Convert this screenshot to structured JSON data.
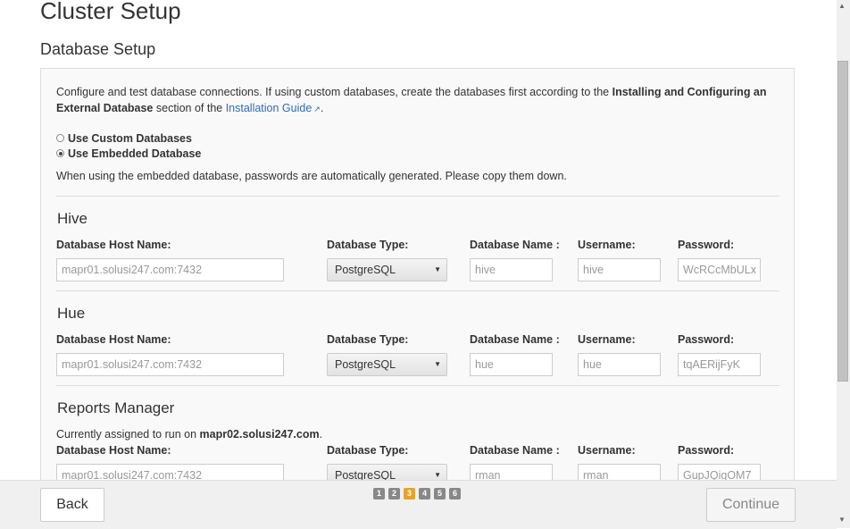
{
  "page_title": "Cluster Setup",
  "section_title": "Database Setup",
  "intro": {
    "text1": "Configure and test database connections. If using custom databases, create the databases first according to the ",
    "bold1": "Installing and Configuring an External Database",
    "text2": " section of the ",
    "link": "Installation Guide",
    "text3": "."
  },
  "radios": [
    {
      "label": "Use Custom Databases",
      "checked": false
    },
    {
      "label": "Use Embedded Database",
      "checked": true
    }
  ],
  "note": "When using the embedded database, passwords are automatically generated. Please copy them down.",
  "column_labels": {
    "host": "Database Host Name:",
    "type": "Database Type:",
    "name": "Database Name :",
    "user": "Username:",
    "pass": "Password:"
  },
  "services": [
    {
      "title": "Hive",
      "host": "mapr01.solusi247.com:7432",
      "type": "PostgreSQL",
      "db_name": "hive",
      "username": "hive",
      "password": "WcRCcMbULx"
    },
    {
      "title": "Hue",
      "host": "mapr01.solusi247.com:7432",
      "type": "PostgreSQL",
      "db_name": "hue",
      "username": "hue",
      "password": "tqAERijFyK"
    },
    {
      "title": "Reports Manager",
      "assigned_text": "Currently assigned to run on ",
      "assigned_host": "mapr02.solusi247.com",
      "assigned_end": ".",
      "host": "mapr01.solusi247.com:7432",
      "type": "PostgreSQL",
      "db_name": "rman",
      "username": "rman",
      "password": "GupJQigOM7"
    }
  ],
  "footer": {
    "back_label": "Back",
    "continue_label": "Continue",
    "steps": [
      "1",
      "2",
      "3",
      "4",
      "5",
      "6"
    ],
    "current_step": "3"
  },
  "colors": {
    "accent_step": "#e5a328",
    "link": "#2a6ebb"
  },
  "icons": {
    "external_link": "external-link-icon",
    "dropdown": "chevron-down-icon"
  }
}
